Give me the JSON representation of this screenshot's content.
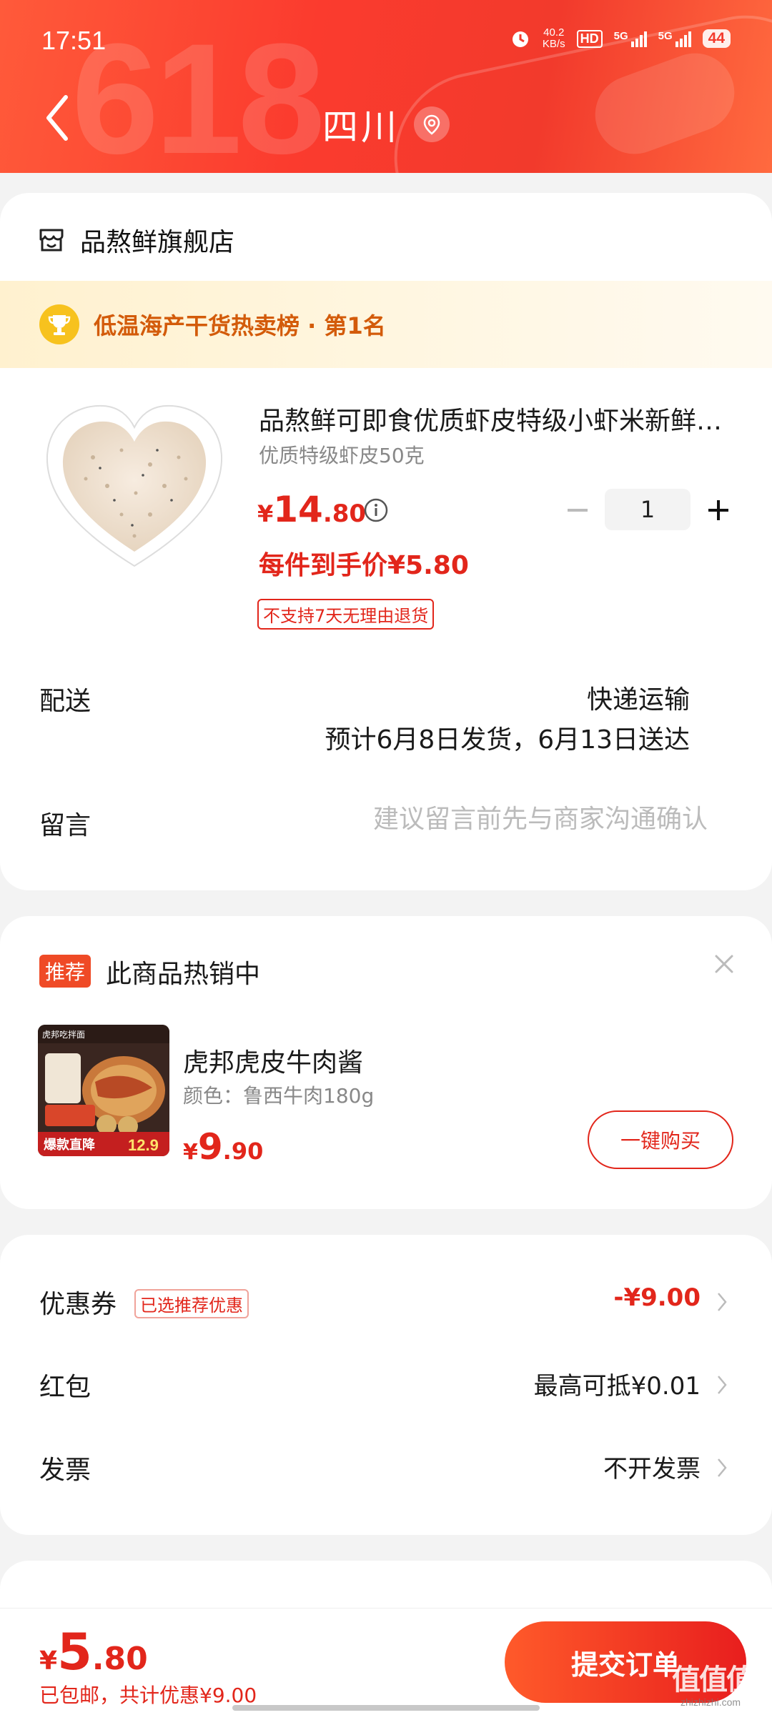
{
  "status_bar": {
    "time": "17:51",
    "net_speed_value": "40.2",
    "net_speed_unit": "KB/s",
    "hd": "HD",
    "sim1": "5G",
    "sim2": "5G",
    "battery": "44"
  },
  "header": {
    "bg_text": "618",
    "location": "四川"
  },
  "shop": {
    "name": "品熬鲜旗舰店"
  },
  "rank": {
    "text": "低温海产干货热卖榜 · 第1名"
  },
  "product": {
    "title": "品熬鲜可即食优质虾皮特级小虾米新鲜淡干",
    "spec": "优质特级虾皮50克",
    "price_symbol": "¥",
    "price_int": "14",
    "price_dec": ".80",
    "quantity": "1",
    "final_price": "每件到手价¥5.80",
    "no_return": "不支持7天无理由退货"
  },
  "shipping": {
    "label": "配送",
    "method": "快递运输",
    "eta": "预计6月8日发货，6月13日送达"
  },
  "message": {
    "label": "留言",
    "placeholder": "建议留言前先与商家沟通确认"
  },
  "recommend": {
    "badge": "推荐",
    "title": "此商品热销中",
    "item_name": "虎邦虎皮牛肉酱",
    "item_spec": "颜色：鲁西牛肉180g",
    "price_symbol": "¥",
    "price_int": "9",
    "price_dec": ".90",
    "buy_label": "一键购买",
    "img_brand": "虎邦吃拌面",
    "img_promo": "爆款直降",
    "img_price": "12.9"
  },
  "summary": {
    "coupon_label": "优惠券",
    "coupon_tag": "已选推荐优惠",
    "coupon_value": "-¥9.00",
    "redpack_label": "红包",
    "redpack_value": "最高可抵¥0.01",
    "invoice_label": "发票",
    "invoice_value": "不开发票"
  },
  "bottom": {
    "price_symbol": "¥",
    "price_int": "5",
    "price_dec": ".80",
    "sub": "已包邮，共计优惠¥9.00",
    "submit": "提交订单",
    "watermark": "值值值",
    "watermark_sub": "zhizhizhi.com"
  },
  "colors": {
    "accent": "#e2261b",
    "header": "#f23a2c",
    "rank_text": "#d35b0a"
  }
}
